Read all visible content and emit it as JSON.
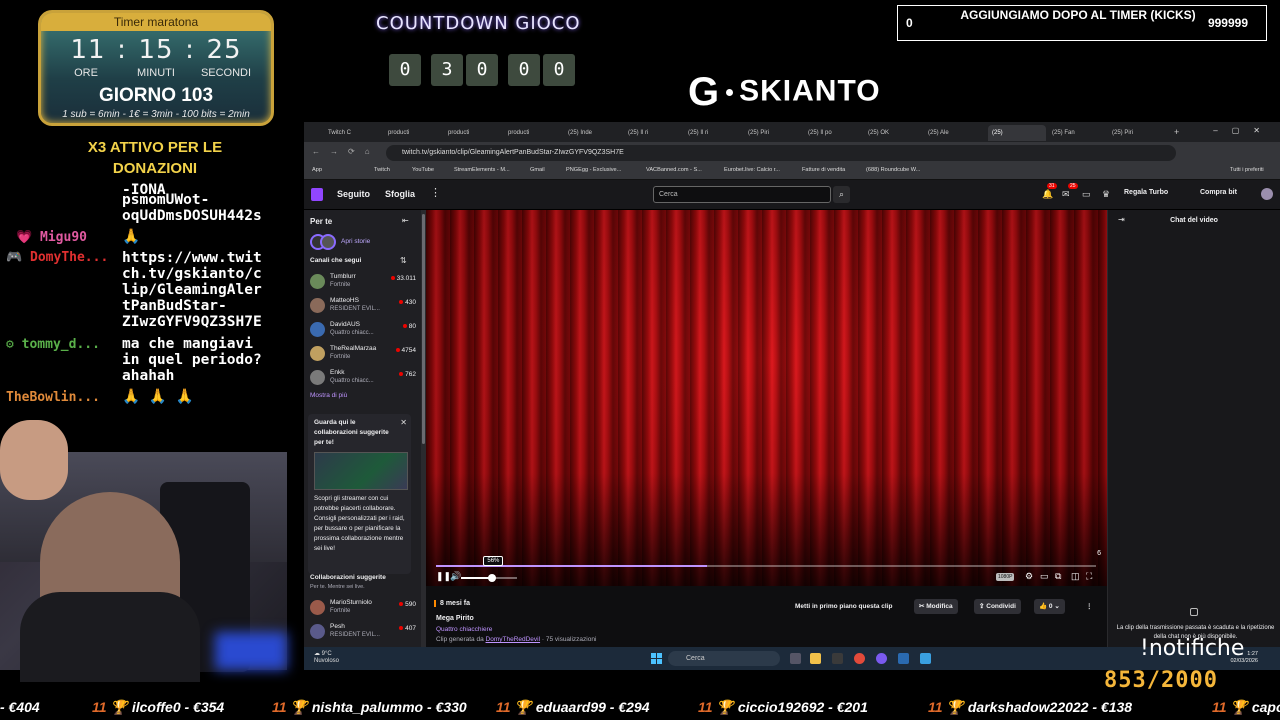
{
  "overlay": {
    "timer": {
      "title": "Timer maratona",
      "hours": "11",
      "minutes": "15",
      "seconds": "25",
      "sep": ":",
      "unit_hours": "ORE",
      "unit_minutes": "MINUTI",
      "unit_seconds": "SECONDI",
      "day": "GIORNO 103",
      "rates": "1 sub = 6min - 1€ = 3min - 100 bits = 2min"
    },
    "countdown": {
      "title": "COUNTDOWN GIOCO",
      "digits": [
        "0",
        "3",
        "0",
        "0",
        "0"
      ]
    },
    "logo": {
      "g": "G",
      "name": "SKIANTO"
    },
    "kick_box": {
      "left": "0",
      "middle": "AGGIUNGIAMO DOPO AL TIMER (KICKS)",
      "right": "999999"
    },
    "x3_banner": "X3 ATTIVO PER LE DONAZIONI",
    "chat": {
      "lines": [
        {
          "name": "",
          "text": "-IONA"
        },
        {
          "name": "",
          "text": "psmomUWot-"
        },
        {
          "name": "",
          "text": "oqUdDmsDOSUH442s"
        },
        {
          "name": "Migu90",
          "text": "🙏"
        },
        {
          "name": "DomyThe...",
          "text": "https://www.twit"
        },
        {
          "name": "",
          "text": "ch.tv/gskianto/c"
        },
        {
          "name": "",
          "text": "lip/GleamingAler"
        },
        {
          "name": "",
          "text": "tPanBudStar-"
        },
        {
          "name": "",
          "text": "ZIwzGYFV9QZ3SH7E"
        },
        {
          "name": "tommy_d...",
          "text": "ma che mangiavi"
        },
        {
          "name": "",
          "text": "in quel periodo?"
        },
        {
          "name": "",
          "text": "ahahah"
        },
        {
          "name": "TheBowlin...",
          "text": "🙏 🙏 🙏"
        }
      ]
    },
    "notifiche": "!notifiche",
    "goal": "853/2000",
    "ticker": [
      "- €404",
      "ilcoffe0 - €354",
      "nishta_palummo - €330",
      "eduaard99 - €294",
      "ciccio192692 - €201",
      "darkshadow22022 - €138",
      "capo"
    ],
    "ticker_prefix": "11 🏆"
  },
  "browser": {
    "tabs": [
      "Twitch C",
      "producti",
      "producti",
      "producti",
      "(25) Inde",
      "(25) Il ri",
      "(25) Il ri",
      "(25) Piri",
      "(25) Il po",
      "(25) OK",
      "(25) Ale",
      "(25)",
      "(25) Fan",
      "(25) Piri"
    ],
    "url": "twitch.tv/gskianto/clip/GleamingAlertPanBudStar-ZIwzGYFV9QZ3SH7E",
    "bookmarks": [
      "App",
      "Twitch",
      "YouTube",
      "StreamElements - M...",
      "Gmail",
      "PNGEgg - Exclusive...",
      "VACBanned.com - S...",
      "Eurobet.live: Calcio r...",
      "Fatture di vendita",
      "(688) Roundcube W...",
      "Tutti i preferiti"
    ]
  },
  "twitch": {
    "nav": {
      "following": "Seguito",
      "browse": "Sfoglia"
    },
    "search_placeholder": "Cerca",
    "badges": {
      "notif": "31",
      "inbox": "25"
    },
    "turbo": "Regala Turbo",
    "bits": "Compra bit",
    "sidebar": {
      "header": "Per te",
      "stories": "Apri storie",
      "followed": "Canali che segui",
      "channels": [
        {
          "name": "Tumblurr",
          "game": "Fortnite",
          "viewers": "33.011",
          "color": "#6a8a5a"
        },
        {
          "name": "MatteoHS",
          "game": "RESIDENT EVIL...",
          "viewers": "430",
          "color": "#8a6a5a"
        },
        {
          "name": "DavidAUS",
          "game": "Quattro chiacc...",
          "viewers": "80",
          "color": "#3a6ab0"
        },
        {
          "name": "TheRealMarzaa",
          "game": "Fortnite",
          "viewers": "4754",
          "color": "#c0a060"
        },
        {
          "name": "Enkk",
          "game": "Quattro chiacc...",
          "viewers": "762",
          "color": "#7a7a7a"
        }
      ],
      "show_more": "Mostra di più",
      "collab_card": {
        "title": "Guarda qui le collaborazioni suggerite per te!",
        "desc": "Scopri gli streamer con cui potrebbe piacerti collaborare. Consigli personalizzati per i raid, per bussare o per pianificare la prossima collaborazione mentre sei live!"
      },
      "suggested_title": "Collaborazioni suggerite",
      "suggested_sub": "Per te. Mentre sei live.",
      "suggested": [
        {
          "name": "MarioSturniolo",
          "game": "Fortnite",
          "viewers": "590",
          "color": "#9a5a4a"
        },
        {
          "name": "Pesh",
          "game": "RESIDENT EVIL...",
          "viewers": "407",
          "color": "#5a5a8a"
        }
      ]
    },
    "player": {
      "volume_pct": "56%",
      "volume": 0.56,
      "progress": 0.41,
      "quality": "1080P",
      "clip_count": "6"
    },
    "info": {
      "age": "8 mesi fa",
      "title": "Mega Pirito",
      "category": "Quattro chiacchiere",
      "by_prefix": "Clip generata da ",
      "by_user": "DomyTheRedDevil",
      "by_suffix": " · 75 visualizzazioni",
      "feature_btn": "Metti in primo piano questa clip",
      "edit_btn": "Modifica",
      "share_btn": "Condividi",
      "likes": "0"
    },
    "video_chat": {
      "title": "Chat del video",
      "message": "La clip della trasmissione passata è scaduta e la ripetizione della chat non è più disponibile."
    }
  },
  "taskbar": {
    "weather_temp": "9°C",
    "weather_label": "Nuvoloso",
    "search": "Cerca",
    "time": "1:27",
    "date": "02/03/2026"
  }
}
